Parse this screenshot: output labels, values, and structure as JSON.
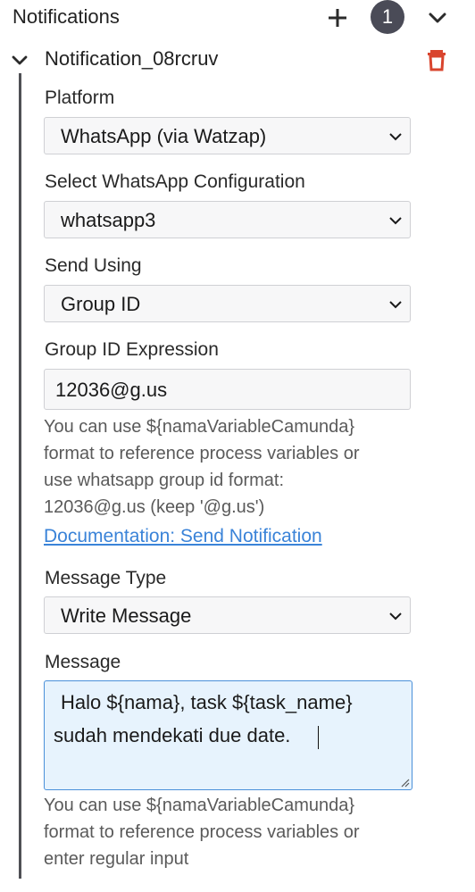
{
  "header": {
    "title": "Notifications",
    "count": "1",
    "add_icon": "plus-icon",
    "collapse_icon": "chevron-down-icon"
  },
  "item": {
    "title": "Notification_08rcruv",
    "toggle_icon": "chevron-down-icon",
    "delete_icon": "trash-icon",
    "delete_color": "#d9452e"
  },
  "fields": {
    "platform": {
      "label": "Platform",
      "value": "WhatsApp (via Watzap)"
    },
    "configuration": {
      "label": "Select WhatsApp Configuration",
      "value": "whatsapp3"
    },
    "send_using": {
      "label": "Send Using",
      "value": "Group ID"
    },
    "group_id": {
      "label": "Group ID Expression",
      "value": "12036@g.us",
      "help": [
        "You can use ${namaVariableCamunda}",
        "format to reference process variables or",
        "use whatsapp group id format:",
        "12036@g.us (keep '@g.us')"
      ],
      "link": "Documentation: Send Notification"
    },
    "message_type": {
      "label": "Message Type",
      "value": "Write Message"
    },
    "message": {
      "label": "Message",
      "lines": [
        "Halo ${nama}, task ${task_name}",
        "sudah mendekati due date."
      ],
      "help": [
        "You can use ${namaVariableCamunda}",
        "format to reference process variables or",
        "enter regular input"
      ]
    }
  },
  "colors": {
    "badge_bg": "#4a4b57",
    "link": "#3a83d8",
    "textarea_focus_bg": "#e7f3fd",
    "textarea_focus_border": "#4a90d9"
  }
}
